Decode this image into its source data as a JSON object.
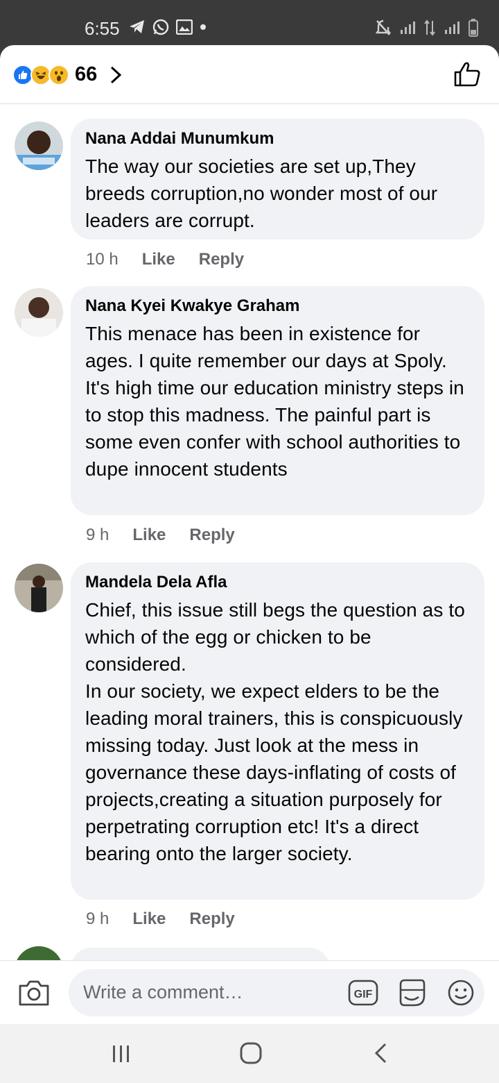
{
  "status_bar": {
    "time": "6:55",
    "left_icons": [
      "telegram-icon",
      "whatsapp-icon",
      "gallery-icon",
      "dot-icon"
    ],
    "right_icons": [
      "mute-icon",
      "signal-icon",
      "data-arrows-icon",
      "signal-icon",
      "battery-icon"
    ]
  },
  "header": {
    "reaction_icons": [
      "like-reaction-icon",
      "haha-reaction-icon",
      "wow-reaction-icon"
    ],
    "reaction_count": "66"
  },
  "comments": [
    {
      "author": "Nana Addai Munumkum",
      "text": "The way our societies are set up,They breeds corruption,no wonder most of our leaders are corrupt.",
      "time": "10 h",
      "like_label": "Like",
      "reply_label": "Reply"
    },
    {
      "author": "Nana Kyei Kwakye Graham",
      "text": "This menace has been in existence for ages. I quite remember our days at Spoly. It's high time our education ministry steps in to stop this madness. The painful part is some even confer with school authorities to dupe innocent students",
      "time": "9 h",
      "like_label": "Like",
      "reply_label": "Reply"
    },
    {
      "author": "Mandela Dela Afla",
      "text": "Chief, this issue still begs the question as to which of the egg or chicken to be considered.\nIn our society, we expect elders to be the leading moral trainers, this is conspicuously missing today. Just look at the mess in governance these days-inflating of costs of projects,creating a situation purposely for perpetrating corruption etc!  It's a direct bearing onto the larger society.",
      "time": "9 h",
      "like_label": "Like",
      "reply_label": "Reply"
    }
  ],
  "composer": {
    "placeholder": "Write a comment…",
    "gif_label": "GIF"
  },
  "colors": {
    "bubble_bg": "#f0f2f5",
    "meta_text": "#65676b",
    "like_blue": "#1877f2",
    "reaction_yellow": "#f7b928",
    "status_bar_bg": "#3a3a3a"
  }
}
